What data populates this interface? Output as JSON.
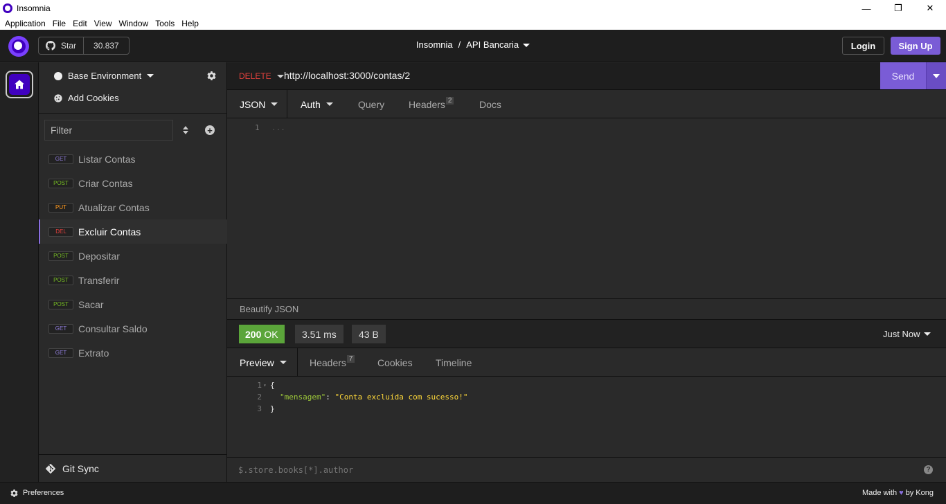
{
  "window": {
    "title": "Insomnia",
    "minimize": "—",
    "maximize": "❐",
    "close": "✕"
  },
  "menu": [
    "Application",
    "File",
    "Edit",
    "View",
    "Window",
    "Tools",
    "Help"
  ],
  "header": {
    "star_label": "Star",
    "star_count": "30.837",
    "breadcrumb_app": "Insomnia",
    "breadcrumb_sep": "/",
    "breadcrumb_project": "API Bancaria",
    "login": "Login",
    "signup": "Sign Up"
  },
  "sidebar": {
    "environment": "Base Environment",
    "add_cookies": "Add Cookies",
    "filter_placeholder": "Filter",
    "requests": [
      {
        "method": "GET",
        "name": "Listar Contas",
        "color": "#8d7bd6",
        "active": false
      },
      {
        "method": "POST",
        "name": "Criar Contas",
        "color": "#75ba24",
        "active": false
      },
      {
        "method": "PUT",
        "name": "Atualizar Contas",
        "color": "#ff9a1f",
        "active": false
      },
      {
        "method": "DEL",
        "name": "Excluir Contas",
        "color": "#e5413d",
        "active": true
      },
      {
        "method": "POST",
        "name": "Depositar",
        "color": "#75ba24",
        "active": false
      },
      {
        "method": "POST",
        "name": "Transferir",
        "color": "#75ba24",
        "active": false
      },
      {
        "method": "POST",
        "name": "Sacar",
        "color": "#75ba24",
        "active": false
      },
      {
        "method": "GET",
        "name": "Consultar Saldo",
        "color": "#8d7bd6",
        "active": false
      },
      {
        "method": "GET",
        "name": "Extrato",
        "color": "#8d7bd6",
        "active": false
      }
    ],
    "git_sync": "Git Sync"
  },
  "request": {
    "method": "DELETE",
    "url": "http://localhost:3000/contas/2",
    "send": "Send",
    "tabs": {
      "body": "JSON",
      "auth": "Auth",
      "query": "Query",
      "headers": "Headers",
      "headers_count": "2",
      "docs": "Docs"
    },
    "editor_line": "1",
    "editor_placeholder": "..."
  },
  "response": {
    "beautify": "Beautify JSON",
    "status_code": "200",
    "status_text": "OK",
    "time": "3.51 ms",
    "size": "43 B",
    "history": "Just Now",
    "tabs": {
      "preview": "Preview",
      "headers": "Headers",
      "headers_count": "7",
      "cookies": "Cookies",
      "timeline": "Timeline"
    },
    "lines": {
      "l1_no": "1",
      "l1": "{",
      "l2_no": "2",
      "l2_key": "\"mensagem\"",
      "l2_colon": ": ",
      "l2_val": "\"Conta excluída com sucesso!\"",
      "l3_no": "3",
      "l3": "}"
    },
    "jsonpath_placeholder": "$.store.books[*].author",
    "help": "?"
  },
  "footer": {
    "preferences": "Preferences",
    "made_with": "Made with",
    "by_kong": "by Kong"
  },
  "colors": {
    "accent": "#7a5cd6",
    "delete": "#e5413d",
    "ok": "#5ba53a"
  }
}
